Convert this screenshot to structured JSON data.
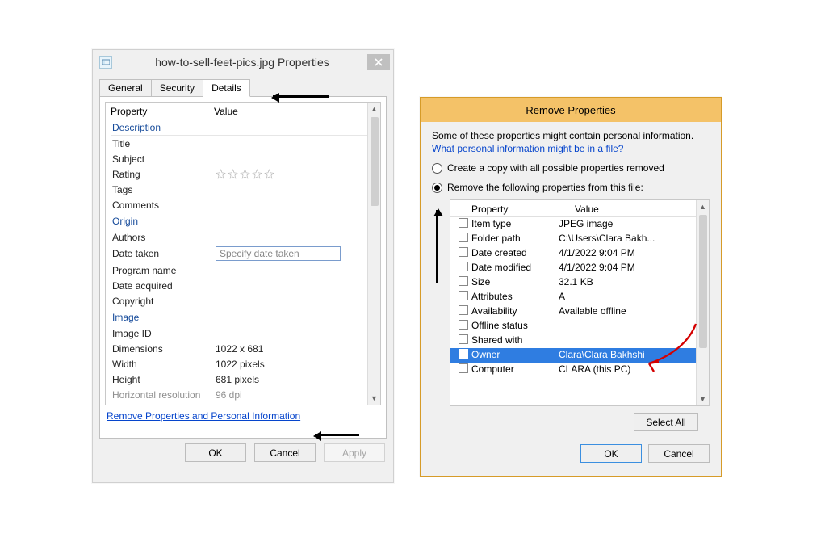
{
  "props": {
    "title": "how-to-sell-feet-pics.jpg Properties",
    "tabs": {
      "general": "General",
      "security": "Security",
      "details": "Details"
    },
    "columns": {
      "property": "Property",
      "value": "Value"
    },
    "sections": {
      "description": "Description",
      "origin": "Origin",
      "image": "Image"
    },
    "rows": {
      "title": "Title",
      "subject": "Subject",
      "rating": "Rating",
      "tags": "Tags",
      "comments": "Comments",
      "authors": "Authors",
      "date_taken": "Date taken",
      "date_taken_placeholder": "Specify date taken",
      "program_name": "Program name",
      "date_acquired": "Date acquired",
      "copyright": "Copyright",
      "image_id": "Image ID",
      "dimensions": "Dimensions",
      "dimensions_val": "1022 x 681",
      "width": "Width",
      "width_val": "1022 pixels",
      "height": "Height",
      "height_val": "681 pixels",
      "hres": "Horizontal resolution",
      "hres_val": "96 dpi"
    },
    "remove_link": "Remove Properties and Personal Information",
    "buttons": {
      "ok": "OK",
      "cancel": "Cancel",
      "apply": "Apply"
    }
  },
  "remove": {
    "title": "Remove Properties",
    "info": "Some of these properties might contain personal information.",
    "info_link": "What personal information might be in a file?",
    "radio1": "Create a copy with all possible properties removed",
    "radio2": "Remove the following properties from this file:",
    "columns": {
      "property": "Property",
      "value": "Value"
    },
    "rows": [
      {
        "p": "Item type",
        "v": "JPEG image"
      },
      {
        "p": "Folder path",
        "v": "C:\\Users\\Clara Bakh..."
      },
      {
        "p": "Date created",
        "v": "4/1/2022 9:04 PM"
      },
      {
        "p": "Date modified",
        "v": "4/1/2022 9:04 PM"
      },
      {
        "p": "Size",
        "v": "32.1 KB"
      },
      {
        "p": "Attributes",
        "v": "A"
      },
      {
        "p": "Availability",
        "v": "Available offline"
      },
      {
        "p": "Offline status",
        "v": ""
      },
      {
        "p": "Shared with",
        "v": ""
      },
      {
        "p": "Owner",
        "v": "Clara\\Clara Bakhshi",
        "selected": true
      },
      {
        "p": "Computer",
        "v": "CLARA (this PC)"
      }
    ],
    "buttons": {
      "select_all": "Select All",
      "ok": "OK",
      "cancel": "Cancel"
    }
  }
}
